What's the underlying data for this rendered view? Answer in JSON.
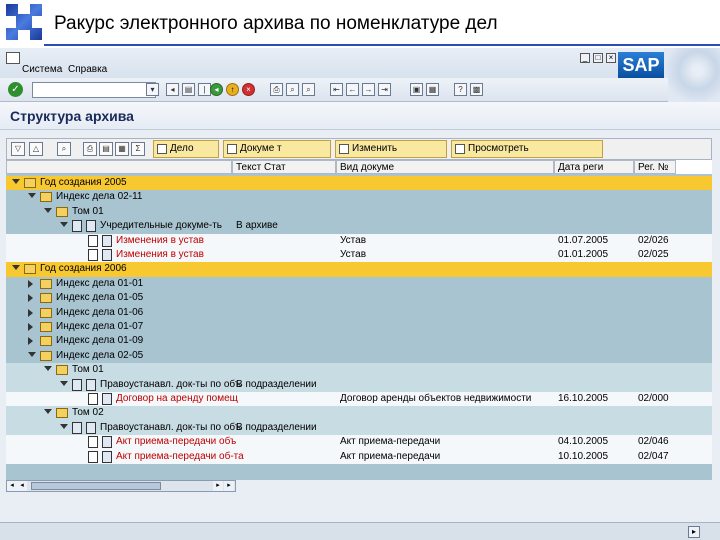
{
  "slide": {
    "title": "Ракурс электронного архива по номенклатуре дел"
  },
  "menu": {
    "items": [
      "Система",
      "Справка"
    ]
  },
  "screen": {
    "title": "Структура архива"
  },
  "tree_toolbar": {
    "buttons": [
      "Дело",
      "Докуме т",
      "Изменить",
      "Просмотреть"
    ]
  },
  "columns": [
    "",
    "Текст Стат",
    "Вид докуме",
    "Дата реги",
    "Рег. №"
  ],
  "rows": [
    {
      "label": "Год создания 2005",
      "status": "",
      "type": "",
      "date": "",
      "num": ""
    },
    {
      "label": "Индекс дела 02-11",
      "status": "",
      "type": "",
      "date": "",
      "num": ""
    },
    {
      "label": "Том 01",
      "status": "",
      "type": "",
      "date": "",
      "num": ""
    },
    {
      "label": "Учредительные докуме-ть",
      "status": "В архиве",
      "type": "",
      "date": "",
      "num": ""
    },
    {
      "label": "Изменения в устав",
      "status": "",
      "type": "Устав",
      "date": "01.07.2005",
      "num": "02/026"
    },
    {
      "label": "Изменения в устав",
      "status": "",
      "type": "Устав",
      "date": "01.01.2005",
      "num": "02/025"
    },
    {
      "label": "Год создания 2006",
      "status": "",
      "type": "",
      "date": "",
      "num": ""
    },
    {
      "label": "Индекс дела 01-01",
      "status": "",
      "type": "",
      "date": "",
      "num": ""
    },
    {
      "label": "Индекс дела 01-05",
      "status": "",
      "type": "",
      "date": "",
      "num": ""
    },
    {
      "label": "Индекс дела 01-06",
      "status": "",
      "type": "",
      "date": "",
      "num": ""
    },
    {
      "label": "Индекс дела 01-07",
      "status": "",
      "type": "",
      "date": "",
      "num": ""
    },
    {
      "label": "Индекс дела 01-09",
      "status": "",
      "type": "",
      "date": "",
      "num": ""
    },
    {
      "label": "Индекс дела 02-05",
      "status": "",
      "type": "",
      "date": "",
      "num": ""
    },
    {
      "label": "Том 01",
      "status": "",
      "type": "",
      "date": "",
      "num": ""
    },
    {
      "label": "Правоустанавл. док-ты по объ",
      "status": "В подразделении",
      "type": "",
      "date": "",
      "num": ""
    },
    {
      "label": "Договор на аренду помещ",
      "status": "",
      "type": "Договор аренды объектов недвижимости",
      "date": "16.10.2005",
      "num": "02/000"
    },
    {
      "label": "Том 02",
      "status": "",
      "type": "",
      "date": "",
      "num": ""
    },
    {
      "label": "Правоустанавл. док-ты по объ",
      "status": "В подразделении",
      "type": "",
      "date": "",
      "num": ""
    },
    {
      "label": "Акт приема-передачи объ",
      "status": "",
      "type": "Акт приема-передачи",
      "date": "04.10.2005",
      "num": "02/046"
    },
    {
      "label": "Акт приема-передачи об-та",
      "status": "",
      "type": "Акт приема-передачи",
      "date": "10.10.2005",
      "num": "02/047"
    }
  ]
}
